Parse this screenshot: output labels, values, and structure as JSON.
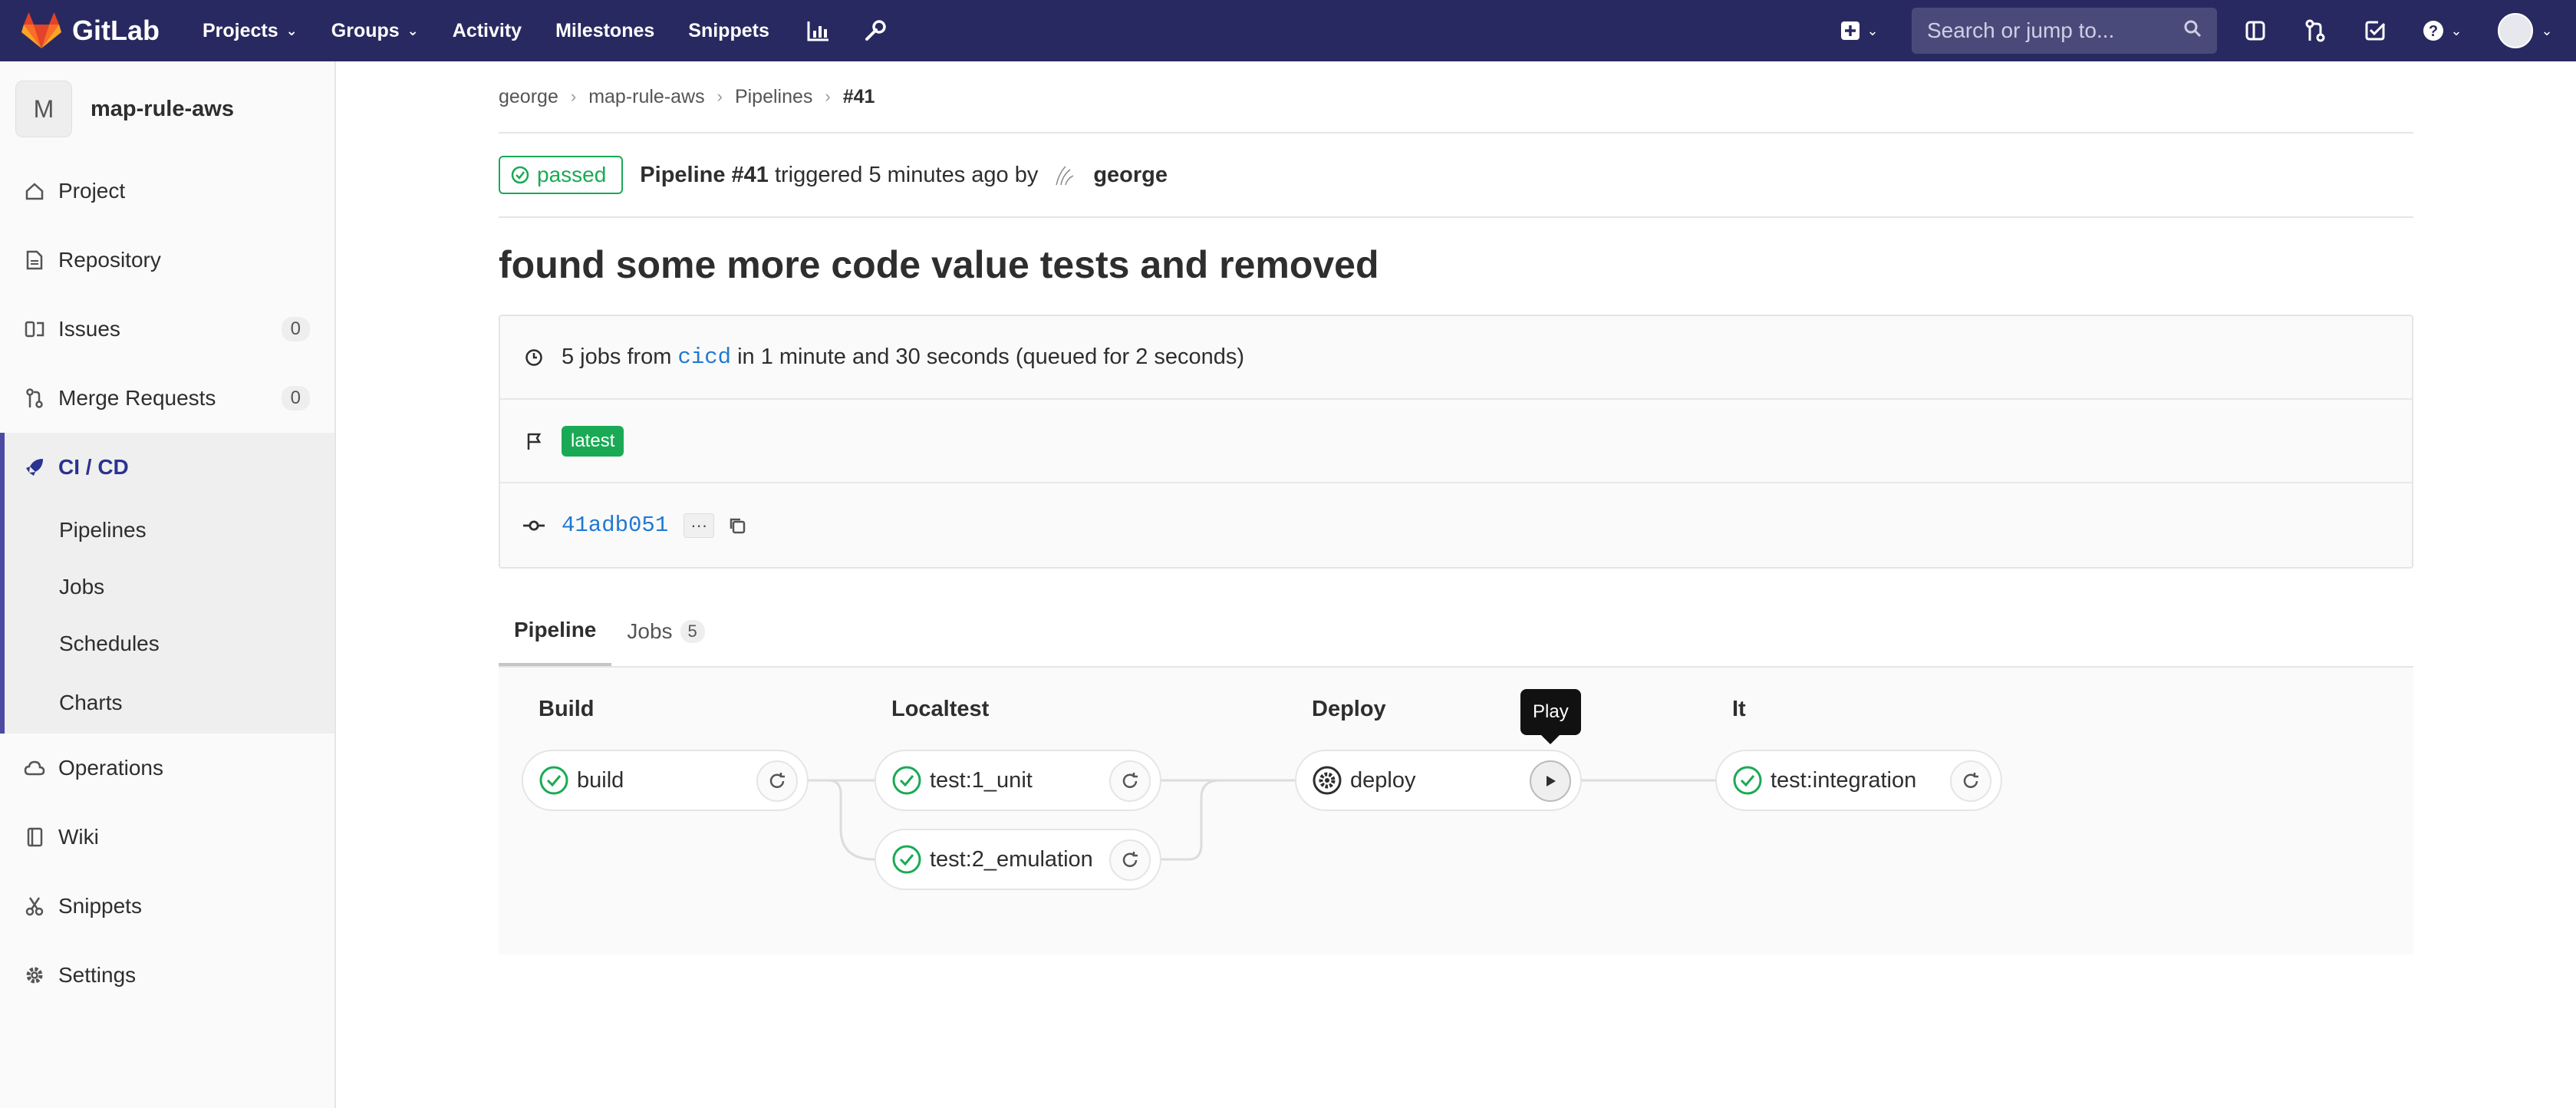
{
  "navbar": {
    "brand": "GitLab",
    "links": [
      "Projects",
      "Groups",
      "Activity",
      "Milestones",
      "Snippets"
    ],
    "search_placeholder": "Search or jump to..."
  },
  "sidebar": {
    "project_initial": "M",
    "project_name": "map-rule-aws",
    "items": [
      {
        "label": "Project",
        "icon": "home-icon"
      },
      {
        "label": "Repository",
        "icon": "doc-icon"
      },
      {
        "label": "Issues",
        "icon": "issues-icon",
        "count": "0"
      },
      {
        "label": "Merge Requests",
        "icon": "merge-icon",
        "count": "0"
      },
      {
        "label": "CI / CD",
        "icon": "rocket-icon"
      },
      {
        "label": "Operations",
        "icon": "cloud-icon"
      },
      {
        "label": "Wiki",
        "icon": "book-icon"
      },
      {
        "label": "Snippets",
        "icon": "scissors-icon"
      },
      {
        "label": "Settings",
        "icon": "gear-icon"
      }
    ],
    "cicd_sub": [
      "Pipelines",
      "Jobs",
      "Schedules",
      "Charts"
    ]
  },
  "breadcrumb": [
    "george",
    "map-rule-aws",
    "Pipelines",
    "#41"
  ],
  "pipeline": {
    "status": "passed",
    "title_bold": "Pipeline #41",
    "triggered_text": "triggered 5 minutes ago by",
    "user": "george",
    "commit_title": "found some more code value tests and removed",
    "jobs_prefix": "5 jobs from",
    "branch": "cicd",
    "jobs_suffix": "in 1 minute and 30 seconds (queued for 2 seconds)",
    "tag": "latest",
    "sha": "41adb051",
    "ellipsis": "···"
  },
  "tabs": [
    {
      "label": "Pipeline"
    },
    {
      "label": "Jobs",
      "count": "5"
    }
  ],
  "graph": {
    "stages": [
      "Build",
      "Localtest",
      "Deploy",
      "It"
    ],
    "jobs": {
      "build": "build",
      "unit": "test:1_unit",
      "emulation": "test:2_emulation",
      "deploy": "deploy",
      "integration": "test:integration"
    },
    "tooltip": "Play"
  },
  "colors": {
    "navbar": "#292961",
    "success": "#1aaa55",
    "link": "#1f78d1",
    "sidebar_active": "#4b4ba3"
  }
}
